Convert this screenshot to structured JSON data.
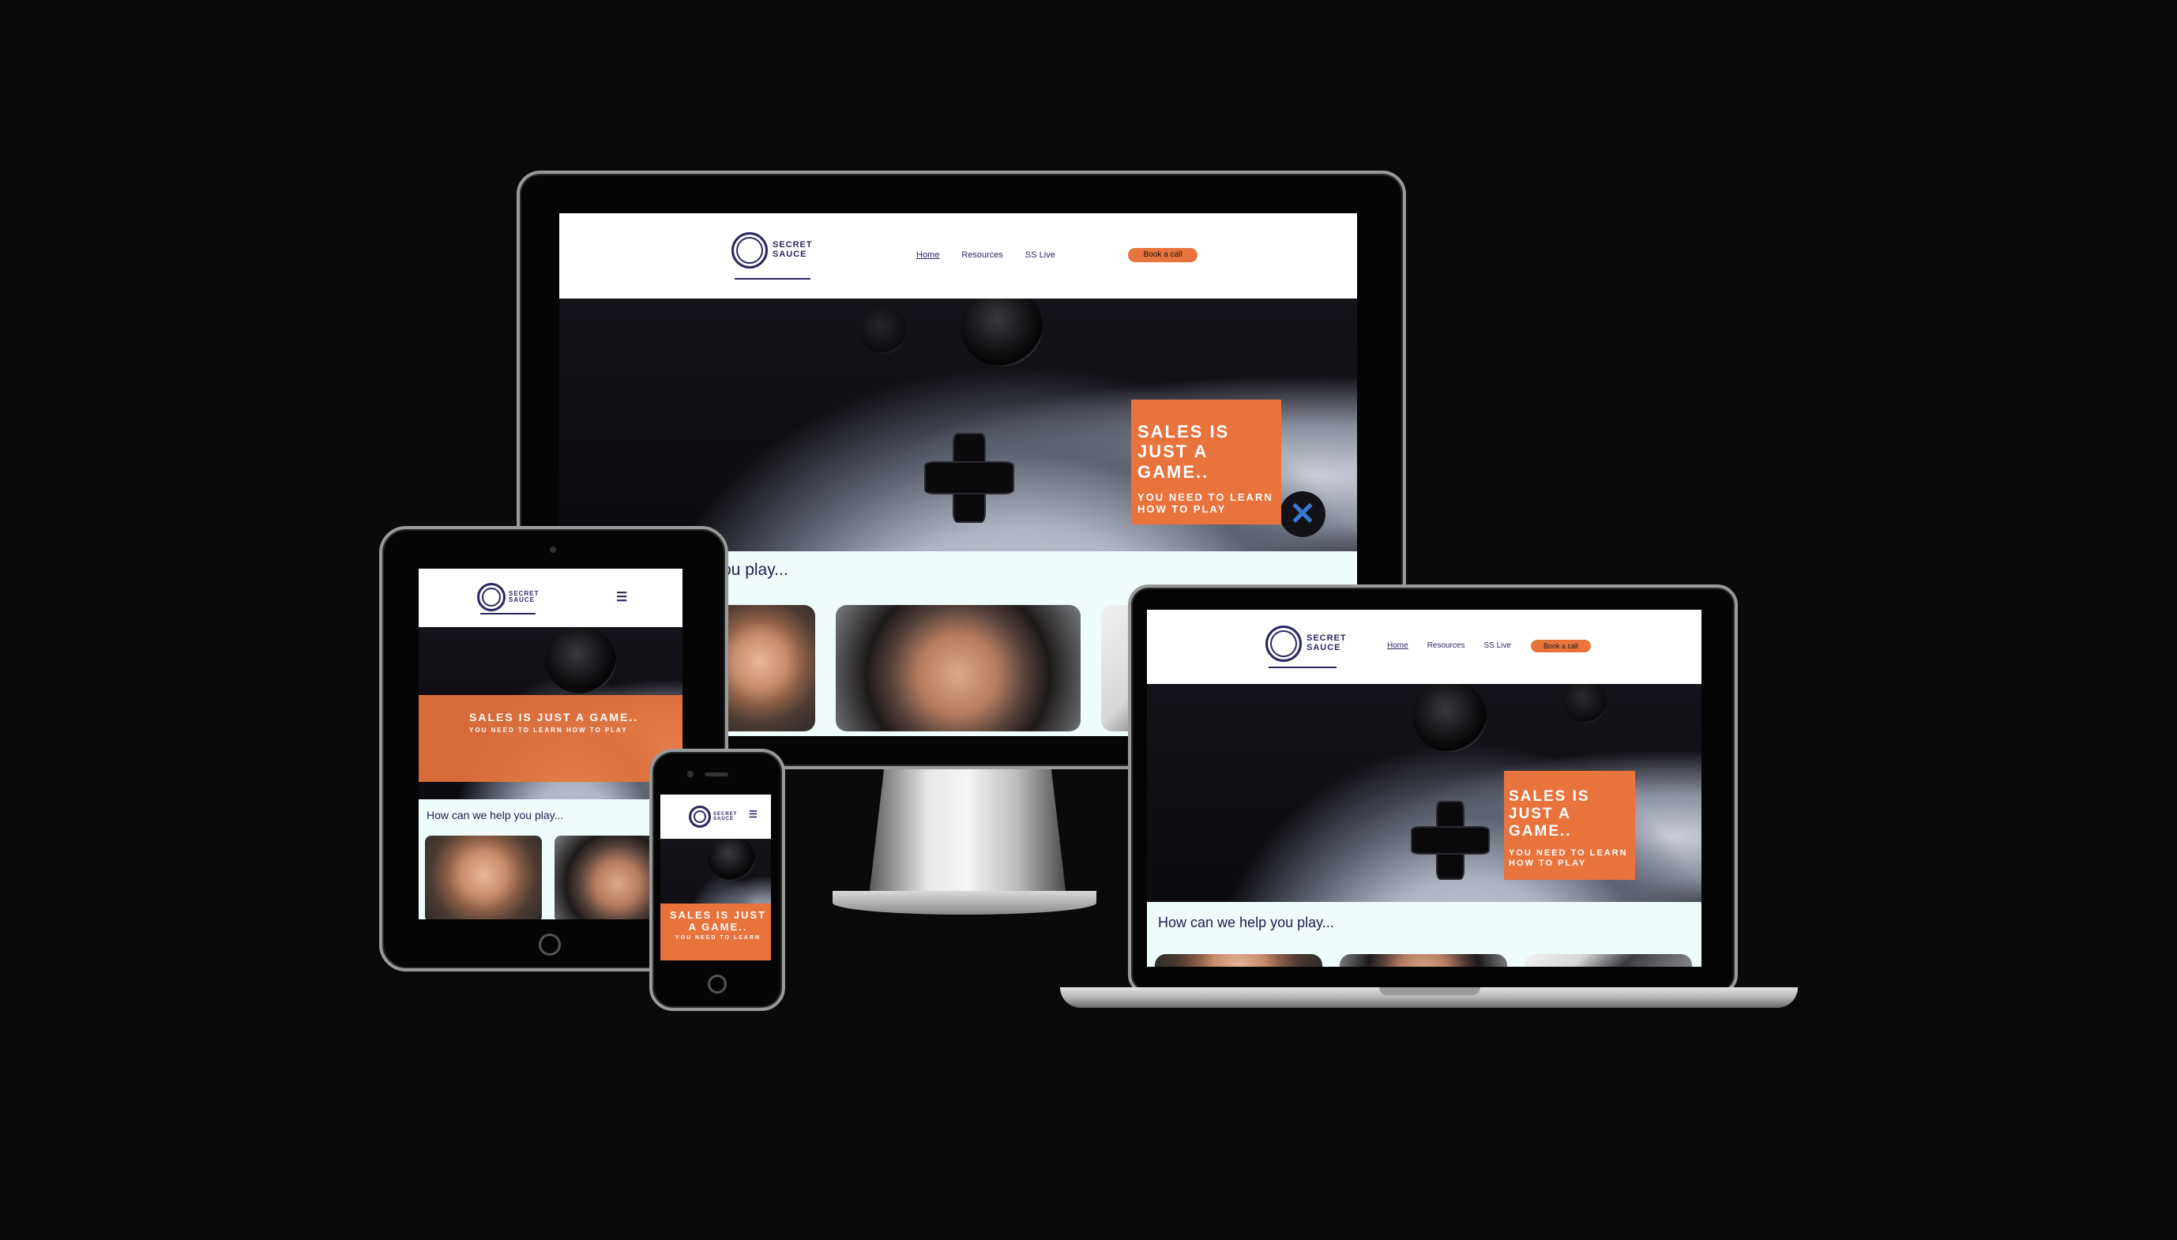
{
  "site": {
    "logo_line1": "SECRET",
    "logo_line2": "SAUCE",
    "nav": [
      "Home",
      "Resources",
      "SS Live"
    ],
    "cta_label": "Book a call",
    "hero_heading": "SALES IS JUST A GAME..",
    "hero_sub": "YOU NEED TO LEARN HOW TO PLAY",
    "monitor_section_title": "ou play...",
    "section_title": "How can we help you play...",
    "phone_hero_heading": "SALES IS JUST A GAME..",
    "phone_hero_sub": "YOU NEED TO LEARN"
  },
  "icons": {
    "menu": "hamburger-icon",
    "controller_button": "x-button-icon"
  },
  "colors": {
    "accent": "#e8733d",
    "navy": "#2a2860",
    "section_bg": "#eefcfb",
    "background": "#0b0a0a"
  }
}
